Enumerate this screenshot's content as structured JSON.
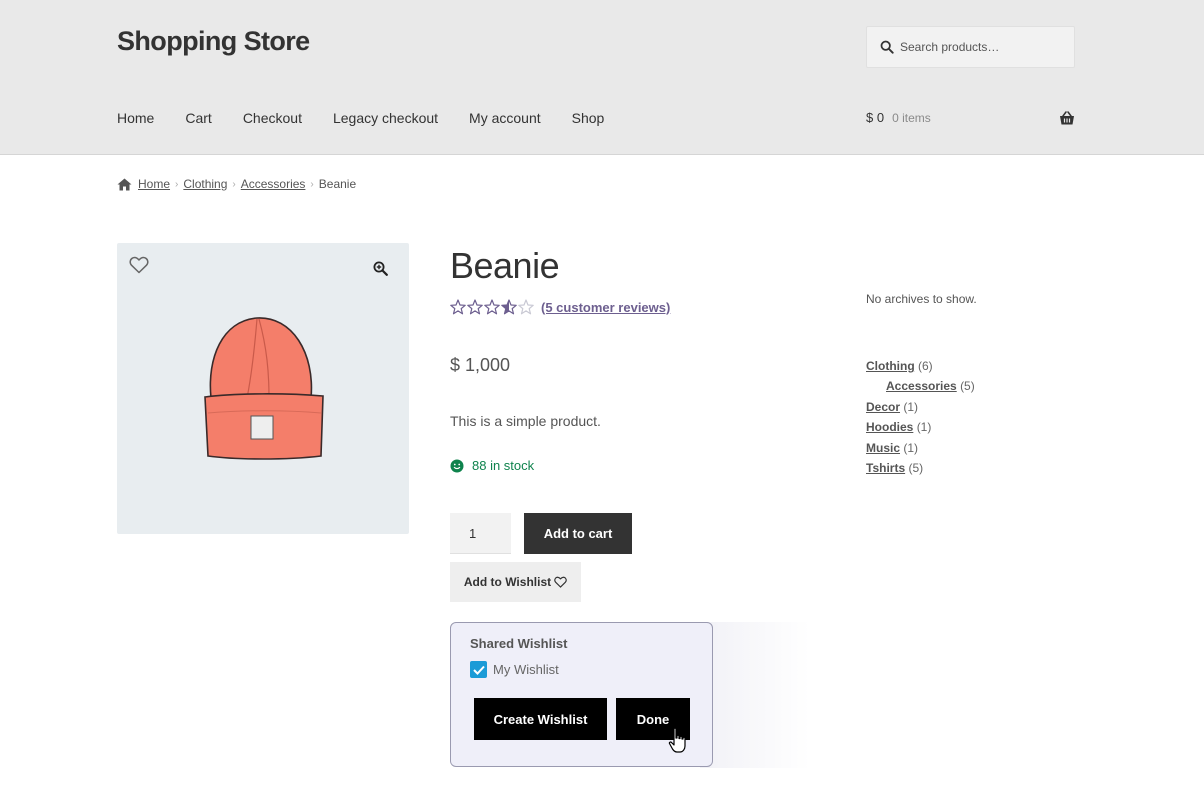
{
  "header": {
    "site_title": "Shopping Store",
    "search_placeholder": "Search products…",
    "nav": [
      "Home",
      "Cart",
      "Checkout",
      "Legacy checkout",
      "My account",
      "Shop"
    ],
    "cart_amount": "$ 0",
    "cart_count": "0 items"
  },
  "breadcrumb": {
    "items": [
      "Home",
      "Clothing",
      "Accessories"
    ],
    "current": "Beanie"
  },
  "product": {
    "title": "Beanie",
    "rating": 3.5,
    "rating_max": 5,
    "reviews_text": "(5 customer reviews)",
    "price": "$ 1,000",
    "description": "This is a simple product.",
    "stock": "88 in stock",
    "quantity": "1",
    "add_to_cart_label": "Add to cart",
    "add_to_wishlist_label": "Add to Wishlist",
    "image_icon": "beanie-image"
  },
  "wishlist_popup": {
    "heading": "Shared Wishlist",
    "list_name": "My Wishlist",
    "list_checked": true,
    "create_label": "Create Wishlist",
    "done_label": "Done"
  },
  "sidebar": {
    "archives_text": "No archives to show.",
    "categories": [
      {
        "name": "Clothing",
        "count": "(6)",
        "child": false
      },
      {
        "name": "Accessories",
        "count": "(5)",
        "child": true
      },
      {
        "name": "Decor",
        "count": "(1)",
        "child": false
      },
      {
        "name": "Hoodies",
        "count": "(1)",
        "child": false
      },
      {
        "name": "Music",
        "count": "(1)",
        "child": false
      },
      {
        "name": "Tshirts",
        "count": "(5)",
        "child": false
      }
    ]
  },
  "colors": {
    "header_bg": "#e9e9e9",
    "button_dark": "#333333",
    "stock_green": "#0f834d",
    "star_purple": "#6d5f8f",
    "checkbox_blue": "#1b9bd7",
    "popup_bg": "#efeff9"
  }
}
